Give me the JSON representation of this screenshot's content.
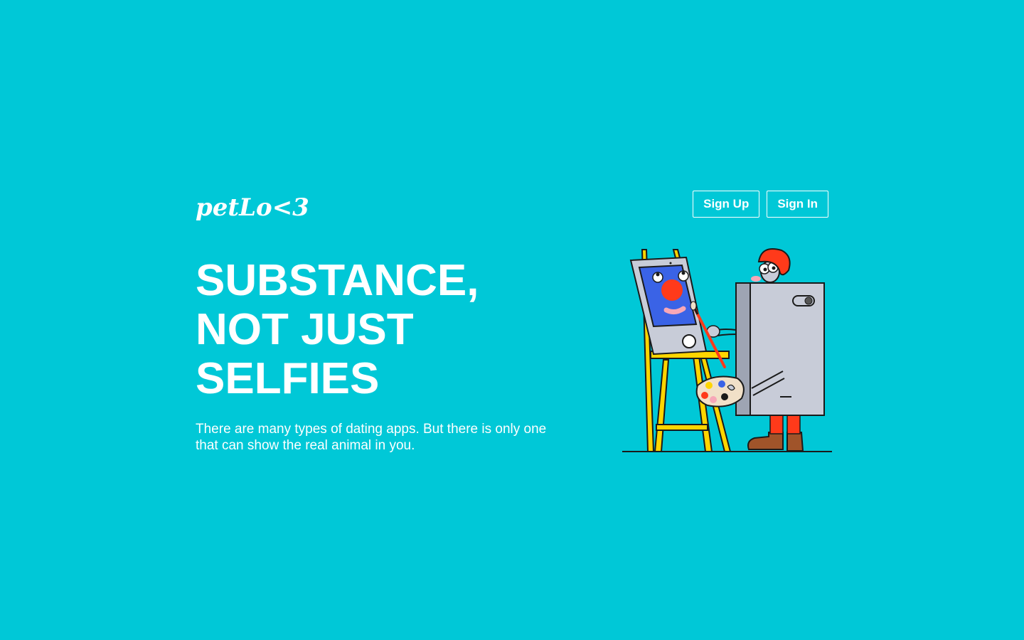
{
  "brand": {
    "logo_text": "petLo<3"
  },
  "nav": {
    "sign_up_label": "Sign Up",
    "sign_in_label": "Sign In"
  },
  "hero": {
    "headline_lines": [
      "SUBSTANCE,",
      "NOT JUST",
      "SELFIES"
    ],
    "subtext": "There are many types of dating apps. But there is only one that can show the real animal in you."
  },
  "illustration": {
    "icon": "painter-at-easel-illustration"
  },
  "colors": {
    "background": "#00c8d7",
    "text": "#ffffff",
    "easel_yellow": "#ffd500",
    "canvas_blue": "#3a63e6",
    "accent_red": "#ff3a1a",
    "fridge_gray": "#c8ccd8",
    "boot_brown": "#a0542a"
  }
}
